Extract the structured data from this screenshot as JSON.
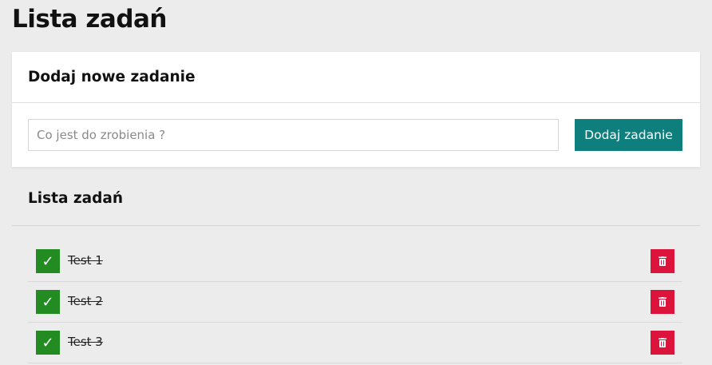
{
  "page": {
    "title": "Lista zadań"
  },
  "add_card": {
    "title": "Dodaj nowe zadanie",
    "input_placeholder": "Co jest do zrobienia ?",
    "input_value": "",
    "button_label": "Dodaj zadanie"
  },
  "list": {
    "title": "Lista zadań",
    "items": [
      {
        "label": "Test 1",
        "done": true
      },
      {
        "label": "Test 2",
        "done": true
      },
      {
        "label": "Test 3",
        "done": true
      }
    ]
  },
  "icons": {
    "check": "check-icon",
    "delete": "trash-icon"
  },
  "colors": {
    "accent": "#0f7f7d",
    "done": "#228b22",
    "delete": "#dc143c",
    "background": "#ececec"
  }
}
